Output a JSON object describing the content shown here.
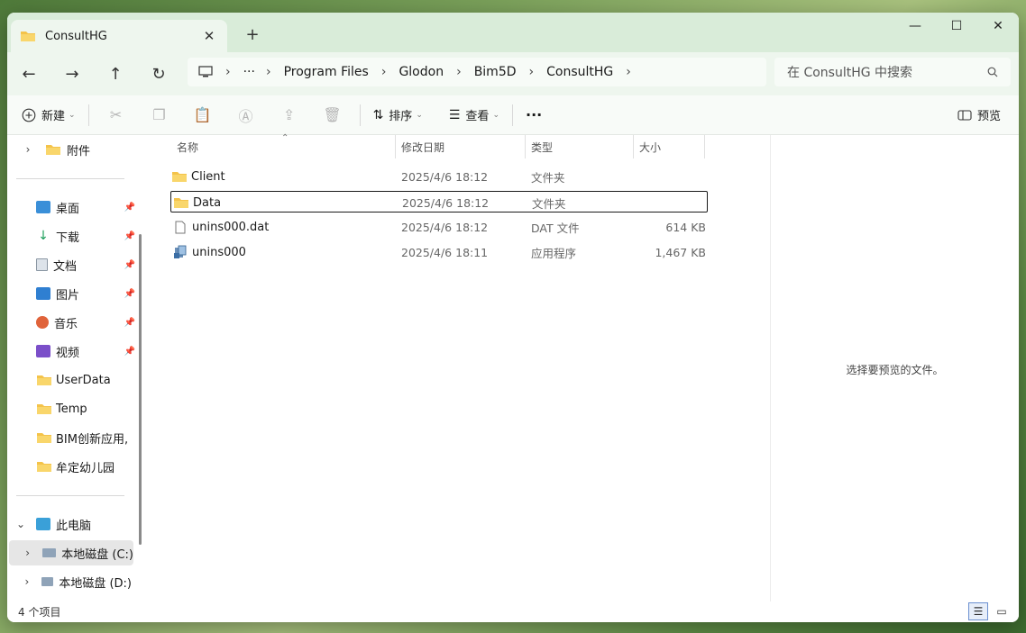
{
  "tab": {
    "title": "ConsultHG"
  },
  "window": {
    "minimize": "—",
    "maximize": "☐",
    "close": "✕"
  },
  "address": {
    "overflow": "···",
    "crumbs": [
      "Program Files",
      "Glodon",
      "Bim5D",
      "ConsultHG"
    ]
  },
  "search": {
    "placeholder": "在 ConsultHG 中搜索"
  },
  "toolbar": {
    "new_label": "新建",
    "sort_label": "排序",
    "view_label": "查看",
    "more_label": "···",
    "preview_label": "预览"
  },
  "sidebar": {
    "top_item": "附件",
    "quick": [
      {
        "label": "桌面",
        "pinned": true
      },
      {
        "label": "下载",
        "pinned": true
      },
      {
        "label": "文档",
        "pinned": true
      },
      {
        "label": "图片",
        "pinned": true
      },
      {
        "label": "音乐",
        "pinned": true
      },
      {
        "label": "视频",
        "pinned": true
      },
      {
        "label": "UserData",
        "pinned": false
      },
      {
        "label": "Temp",
        "pinned": false
      },
      {
        "label": "BIM创新应用,",
        "pinned": false
      },
      {
        "label": "牟定幼儿园",
        "pinned": false
      }
    ],
    "this_pc": "此电脑",
    "drives": [
      "本地磁盘 (C:)",
      "本地磁盘 (D:)"
    ]
  },
  "columns": {
    "name": "名称",
    "date": "修改日期",
    "type": "类型",
    "size": "大小"
  },
  "files": [
    {
      "name": "Client",
      "date": "2025/4/6 18:12",
      "type": "文件夹",
      "size": "",
      "kind": "folder"
    },
    {
      "name": "Data",
      "date": "2025/4/6 18:12",
      "type": "文件夹",
      "size": "",
      "kind": "folder"
    },
    {
      "name": "unins000.dat",
      "date": "2025/4/6 18:12",
      "type": "DAT 文件",
      "size": "614 KB",
      "kind": "file"
    },
    {
      "name": "unins000",
      "date": "2025/4/6 18:11",
      "type": "应用程序",
      "size": "1,467 KB",
      "kind": "app"
    }
  ],
  "preview": {
    "empty_text": "选择要预览的文件。"
  },
  "status": {
    "count": "4 个项目"
  },
  "colors": {
    "accent": "#1a73e8",
    "folder": "#f4c34a",
    "chrome": "#d9ecd9"
  }
}
